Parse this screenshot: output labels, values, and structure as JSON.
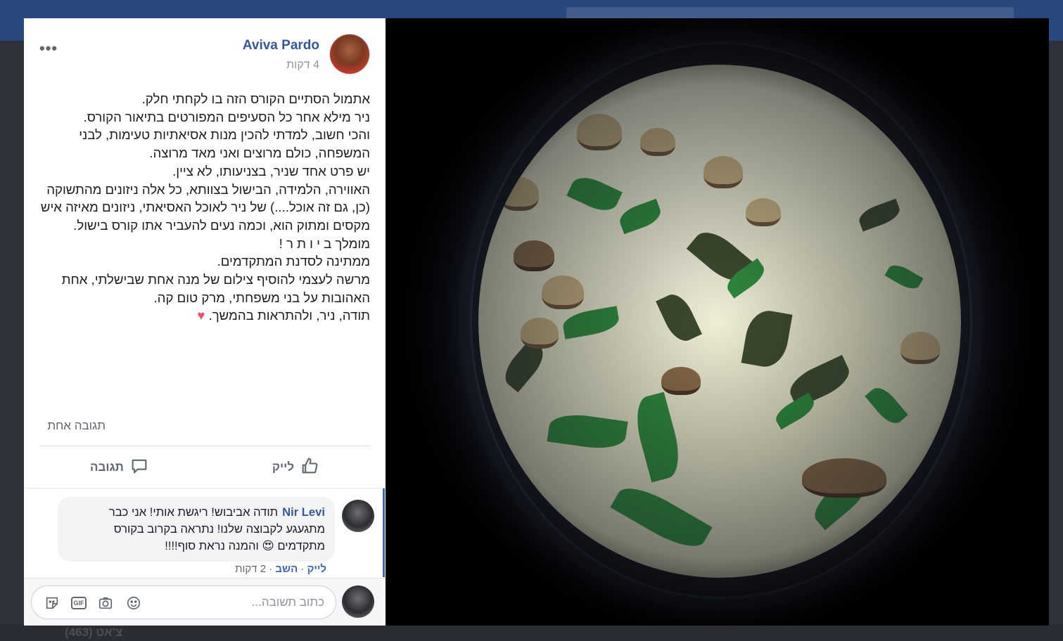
{
  "background": {
    "chat_label": "צ'אט (463)"
  },
  "post": {
    "author": "Aviva Pardo",
    "time": "4 דקות",
    "body_lines": [
      "אתמול הסתיים הקורס הזה בו לקחתי חלק.",
      "ניר מילא אחר כל הסעיפים המפורטים בתיאור הקורס.",
      "והכי חשוב, למדתי להכין מנות אסיאתיות טעימות, לבני המשפחה, כולם מרוצים ואני מאד מרוצה.",
      "יש פרט אחד שניר, בצניעותו, לא ציין.",
      "האווירה, הלמידה, הבישול בצוותא, כל אלה ניזונים מהתשוקה (כן, גם זה אוכל....) של ניר לאוכל האסיאתי, ניזונים מאיזה איש מקסים ומתוק הוא, וכמה נעים להעביר אתו קורס בישול.",
      "מומלך ב י ו ת ר !",
      "ממתינה לסדנת המתקדמים.",
      "מרשה לעצמי להוסיף צילום של מנה אחת שבישלתי, אחת האהובות על בני משפחתי, מרק טום קה.",
      "תודה, ניר, ולהתראות בהמשך."
    ],
    "heart": "♥",
    "comment_count": "תגובה אחת",
    "like_label": "לייק",
    "comment_label": "תגובה"
  },
  "comment": {
    "author": "Nir Levi",
    "text": "תודה אביבוש! ריגשת אותי! אני כבר מתגעגע לקבוצה שלנו! נתראה בקרוב בקורס מתקדמים 😍 והמנה נראת סוף!!!!",
    "like_label": "לייק",
    "reply_label": "השב",
    "dot": "·",
    "time": "2 דקות"
  },
  "composer": {
    "placeholder": "כתוב תשובה...",
    "gif_label": "GIF"
  }
}
